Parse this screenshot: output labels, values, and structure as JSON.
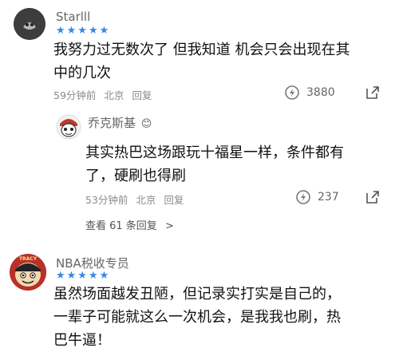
{
  "comments": [
    {
      "username": "Starlll",
      "stars": "★★★★★",
      "text_line1": "我努力过无数次了 但我知道 机会只会出现在其",
      "text_line2": "中的几次",
      "time": "59分钟前",
      "location": "北京",
      "reply_label": "回复",
      "likes": "3880"
    },
    {
      "username": "乔克斯基",
      "badge": "😊",
      "text_line1": "其实热巴这场跟玩十福星一样，条件都有",
      "text_line2": "了，硬刷也得刷",
      "time": "53分钟前",
      "location": "北京",
      "reply_label": "回复",
      "likes": "237",
      "view_replies": "查看 61 条回复",
      "view_replies_arrow": ">"
    },
    {
      "username": "NBA税收专员",
      "stars": "★★★★★",
      "avatar_text": "TRACY",
      "text_line1": "虽然场面越发丑陋，但记录实打实是自己的，",
      "text_line2": "一辈子可能就这么一次机会，是我我也刷，热",
      "text_line3": "巴牛逼！"
    }
  ],
  "colors": {
    "star": "#3a86e8",
    "meta": "#8a8a8a"
  }
}
